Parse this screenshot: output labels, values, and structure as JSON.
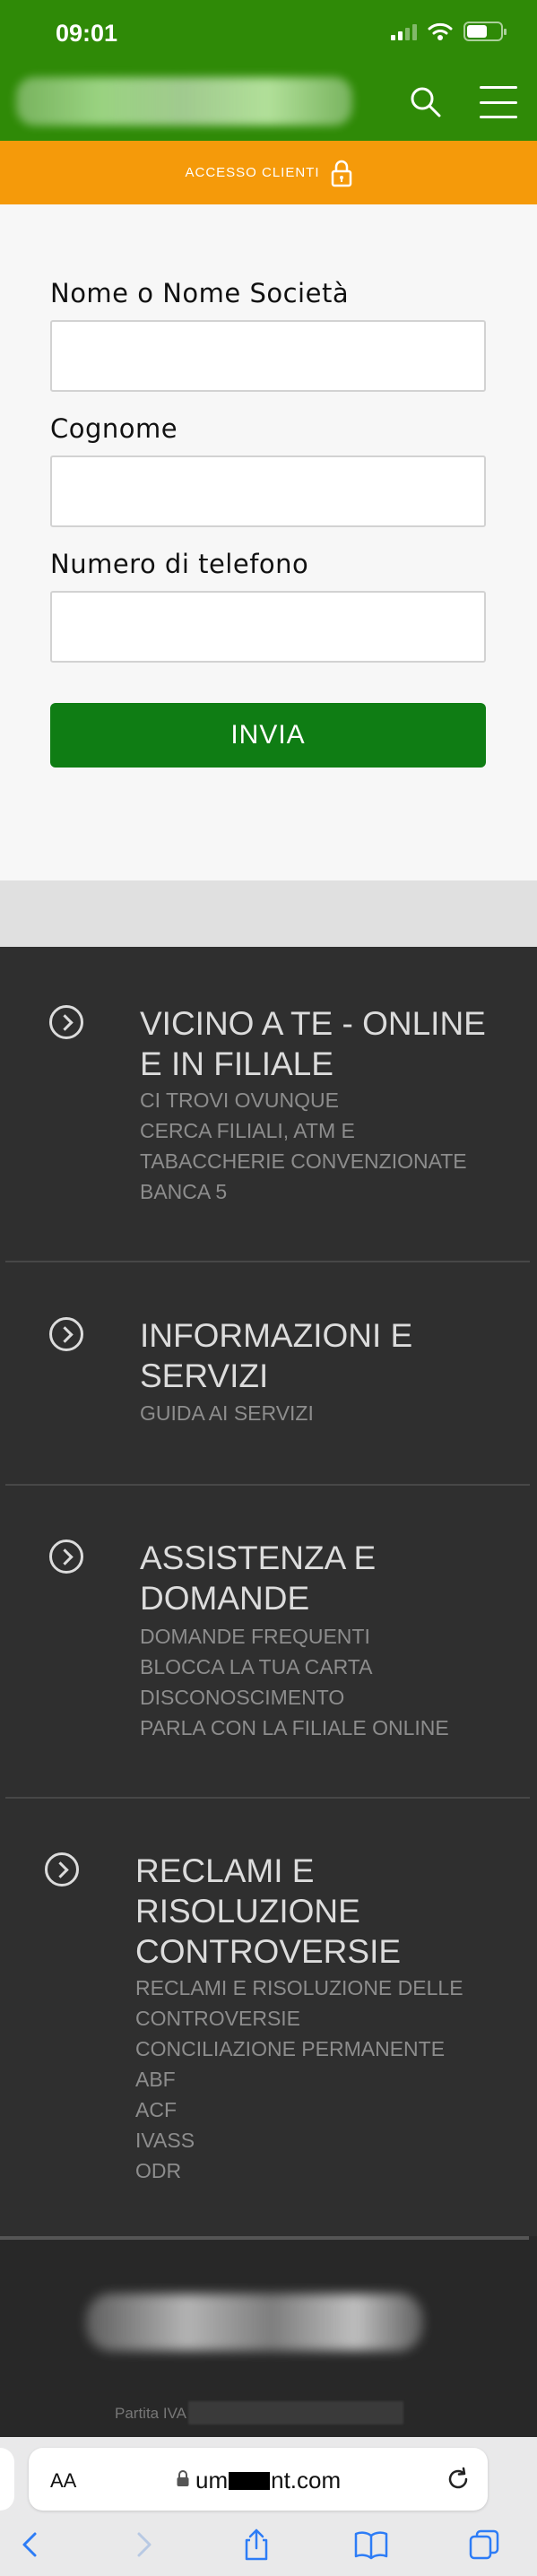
{
  "status_bar": {
    "time": "09:01"
  },
  "header": {
    "access_label": "ACCESSO CLIENTI"
  },
  "form": {
    "fields": [
      {
        "label": "Nome o Nome Società",
        "value": "",
        "placeholder": ""
      },
      {
        "label": "Cognome",
        "value": "",
        "placeholder": ""
      },
      {
        "label": "Numero di telefono",
        "value": "",
        "placeholder": ""
      }
    ],
    "submit_label": "INVIA"
  },
  "footer": {
    "sections": [
      {
        "title_lines": [
          "VICINO A TE - ONLINE",
          "E IN FILIALE"
        ],
        "links": [
          "CI TROVI OVUNQUE",
          "CERCA FILIALI, ATM E",
          "TABACCHERIE CONVENZIONATE",
          "BANCA 5"
        ]
      },
      {
        "title_lines": [
          "INFORMAZIONI E",
          "SERVIZI"
        ],
        "links": [
          "GUIDA AI SERVIZI"
        ]
      },
      {
        "title_lines": [
          "ASSISTENZA E",
          "DOMANDE"
        ],
        "links": [
          "DOMANDE FREQUENTI",
          "BLOCCA LA TUA CARTA",
          "DISCONOSCIMENTO",
          "PARLA CON LA FILIALE ONLINE"
        ]
      },
      {
        "title_lines": [
          "RECLAMI E",
          "RISOLUZIONE",
          "CONTROVERSIE"
        ],
        "links": [
          "RECLAMI E RISOLUZIONE DELLE",
          "CONTROVERSIE",
          "CONCILIAZIONE PERMANENTE",
          "ABF",
          "ACF",
          "IVASS",
          "ODR"
        ]
      }
    ],
    "vat_label": "Partita IVA"
  },
  "browser": {
    "text_size_label": "AA",
    "url_prefix": "um",
    "url_suffix": "nt.com"
  },
  "colors": {
    "header_green": "#2f8a07",
    "access_orange": "#f59a0a",
    "submit_green": "#0f7d14",
    "footer_dark": "#2f2f2f"
  }
}
